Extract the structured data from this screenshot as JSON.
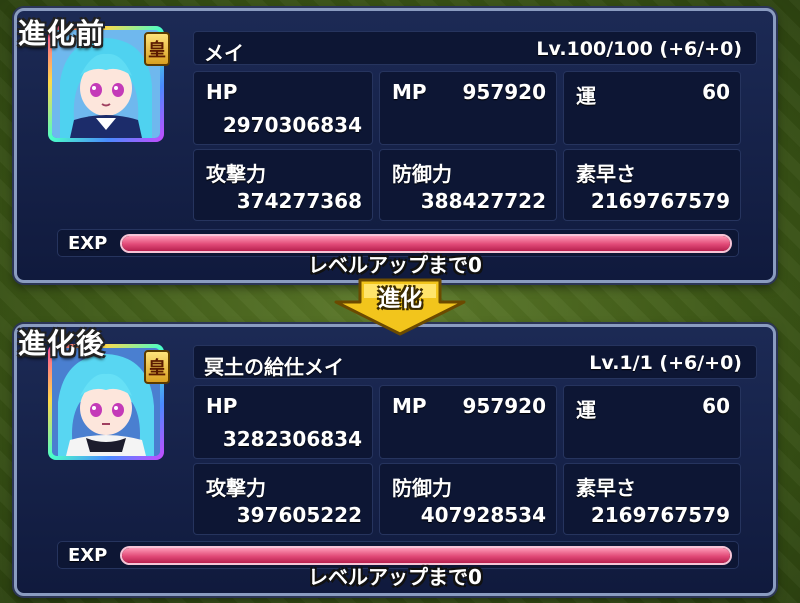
{
  "evolve_label": "進化",
  "colors": {
    "panel_bg": "#101a3d",
    "exp_fill": "#e14a77",
    "arrow": "#f2c51c"
  },
  "before": {
    "section_label": "進化前",
    "rank": "皇",
    "name": "メイ",
    "level": "Lv.100/100 (+6/+0)",
    "hp_label": "HP",
    "hp": "2970306834",
    "mp_label": "MP",
    "mp": "957920",
    "luck_label": "運",
    "luck": "60",
    "atk_label": "攻撃力",
    "atk": "374277368",
    "def_label": "防御力",
    "def": "388427722",
    "spd_label": "素早さ",
    "spd": "2169767579",
    "exp_label": "EXP",
    "exp_progress": 1.0,
    "exp_caption": "レベルアップまで0"
  },
  "after": {
    "section_label": "進化後",
    "rank": "皇",
    "name": "冥土の給仕メイ",
    "level": "Lv.1/1 (+6/+0)",
    "hp_label": "HP",
    "hp": "3282306834",
    "mp_label": "MP",
    "mp": "957920",
    "luck_label": "運",
    "luck": "60",
    "atk_label": "攻撃力",
    "atk": "397605222",
    "def_label": "防御力",
    "def": "407928534",
    "spd_label": "素早さ",
    "spd": "2169767579",
    "exp_label": "EXP",
    "exp_progress": 1.0,
    "exp_caption": "レベルアップまで0"
  }
}
